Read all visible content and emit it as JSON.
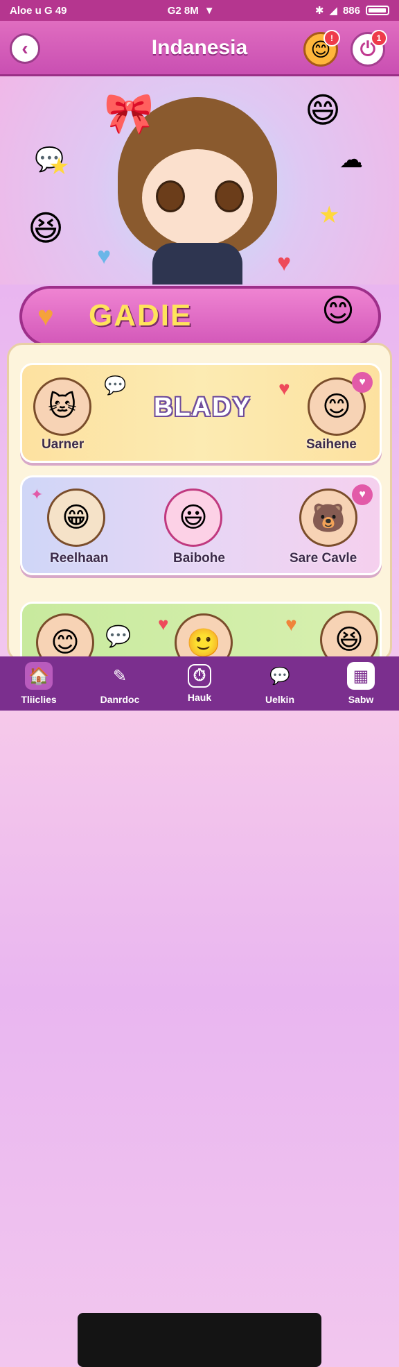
{
  "status_bar": {
    "left": "Aloe u G 49",
    "center": "G2 8M",
    "right": "886"
  },
  "header": {
    "title": "Indanesia",
    "notif_badge": "1"
  },
  "banner": {
    "title": "GADIE"
  },
  "cards": {
    "card1": {
      "center_label": "BLADY",
      "left_name": "Uarner",
      "right_name": "Saihene"
    },
    "card2": {
      "left_name": "Reelhaan",
      "center_name": "Baibohe",
      "right_name": "Sare Cavle"
    }
  },
  "tabs": [
    {
      "label": "Tliiclies",
      "icon": "home-icon"
    },
    {
      "label": "Danrdoc",
      "icon": "pen-icon"
    },
    {
      "label": "Hauk",
      "icon": "timer-icon"
    },
    {
      "label": "Uelkin",
      "icon": "chat-icon"
    },
    {
      "label": "Sabw",
      "icon": "grid-icon"
    }
  ],
  "colors": {
    "header": "#d15ab6",
    "banner": "#e676c9",
    "tabbar": "#7b2f8e"
  }
}
